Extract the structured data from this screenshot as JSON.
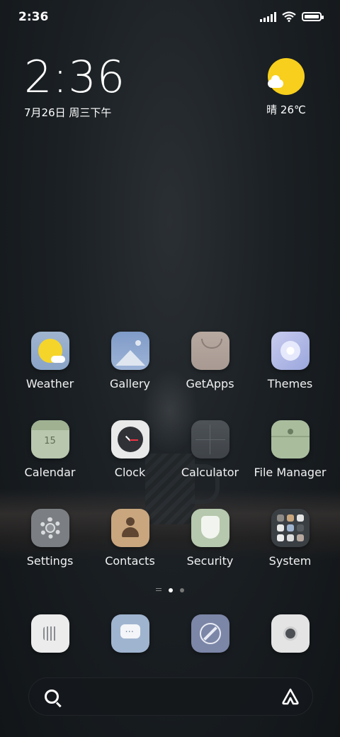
{
  "status_bar": {
    "time": "2:36",
    "icons": [
      "signal-icon",
      "wifi-icon",
      "battery-icon"
    ]
  },
  "clock_widget": {
    "time": "2:36",
    "date": "7月26日 周三下午"
  },
  "weather_widget": {
    "icon": "sunny-cloud-icon",
    "text": "晴 26℃"
  },
  "apps": {
    "row1": [
      {
        "label": "Weather",
        "icon": "weather-icon"
      },
      {
        "label": "Gallery",
        "icon": "gallery-icon"
      },
      {
        "label": "GetApps",
        "icon": "getapps-icon"
      },
      {
        "label": "Themes",
        "icon": "themes-icon"
      }
    ],
    "row2": [
      {
        "label": "Calendar",
        "icon": "calendar-icon",
        "badge": "15"
      },
      {
        "label": "Clock",
        "icon": "clock-icon"
      },
      {
        "label": "Calculator",
        "icon": "calculator-icon"
      },
      {
        "label": "File Manager",
        "icon": "file-manager-icon"
      }
    ],
    "row3": [
      {
        "label": "Settings",
        "icon": "settings-icon"
      },
      {
        "label": "Contacts",
        "icon": "contacts-icon"
      },
      {
        "label": "Security",
        "icon": "security-icon"
      },
      {
        "label": "System",
        "icon": "system-folder-icon"
      }
    ]
  },
  "page_indicator": {
    "pages": 2,
    "active": 1
  },
  "dock": [
    {
      "icon": "phone-icon"
    },
    {
      "icon": "messaging-icon"
    },
    {
      "icon": "browser-icon"
    },
    {
      "icon": "camera-icon"
    }
  ],
  "search_bar": {
    "left_icon": "search-icon",
    "right_icon": "assistant-icon"
  },
  "colors": {
    "weather_sun": "#f7cf1c",
    "background": "#1b2024",
    "accent_white": "#ffffff"
  }
}
